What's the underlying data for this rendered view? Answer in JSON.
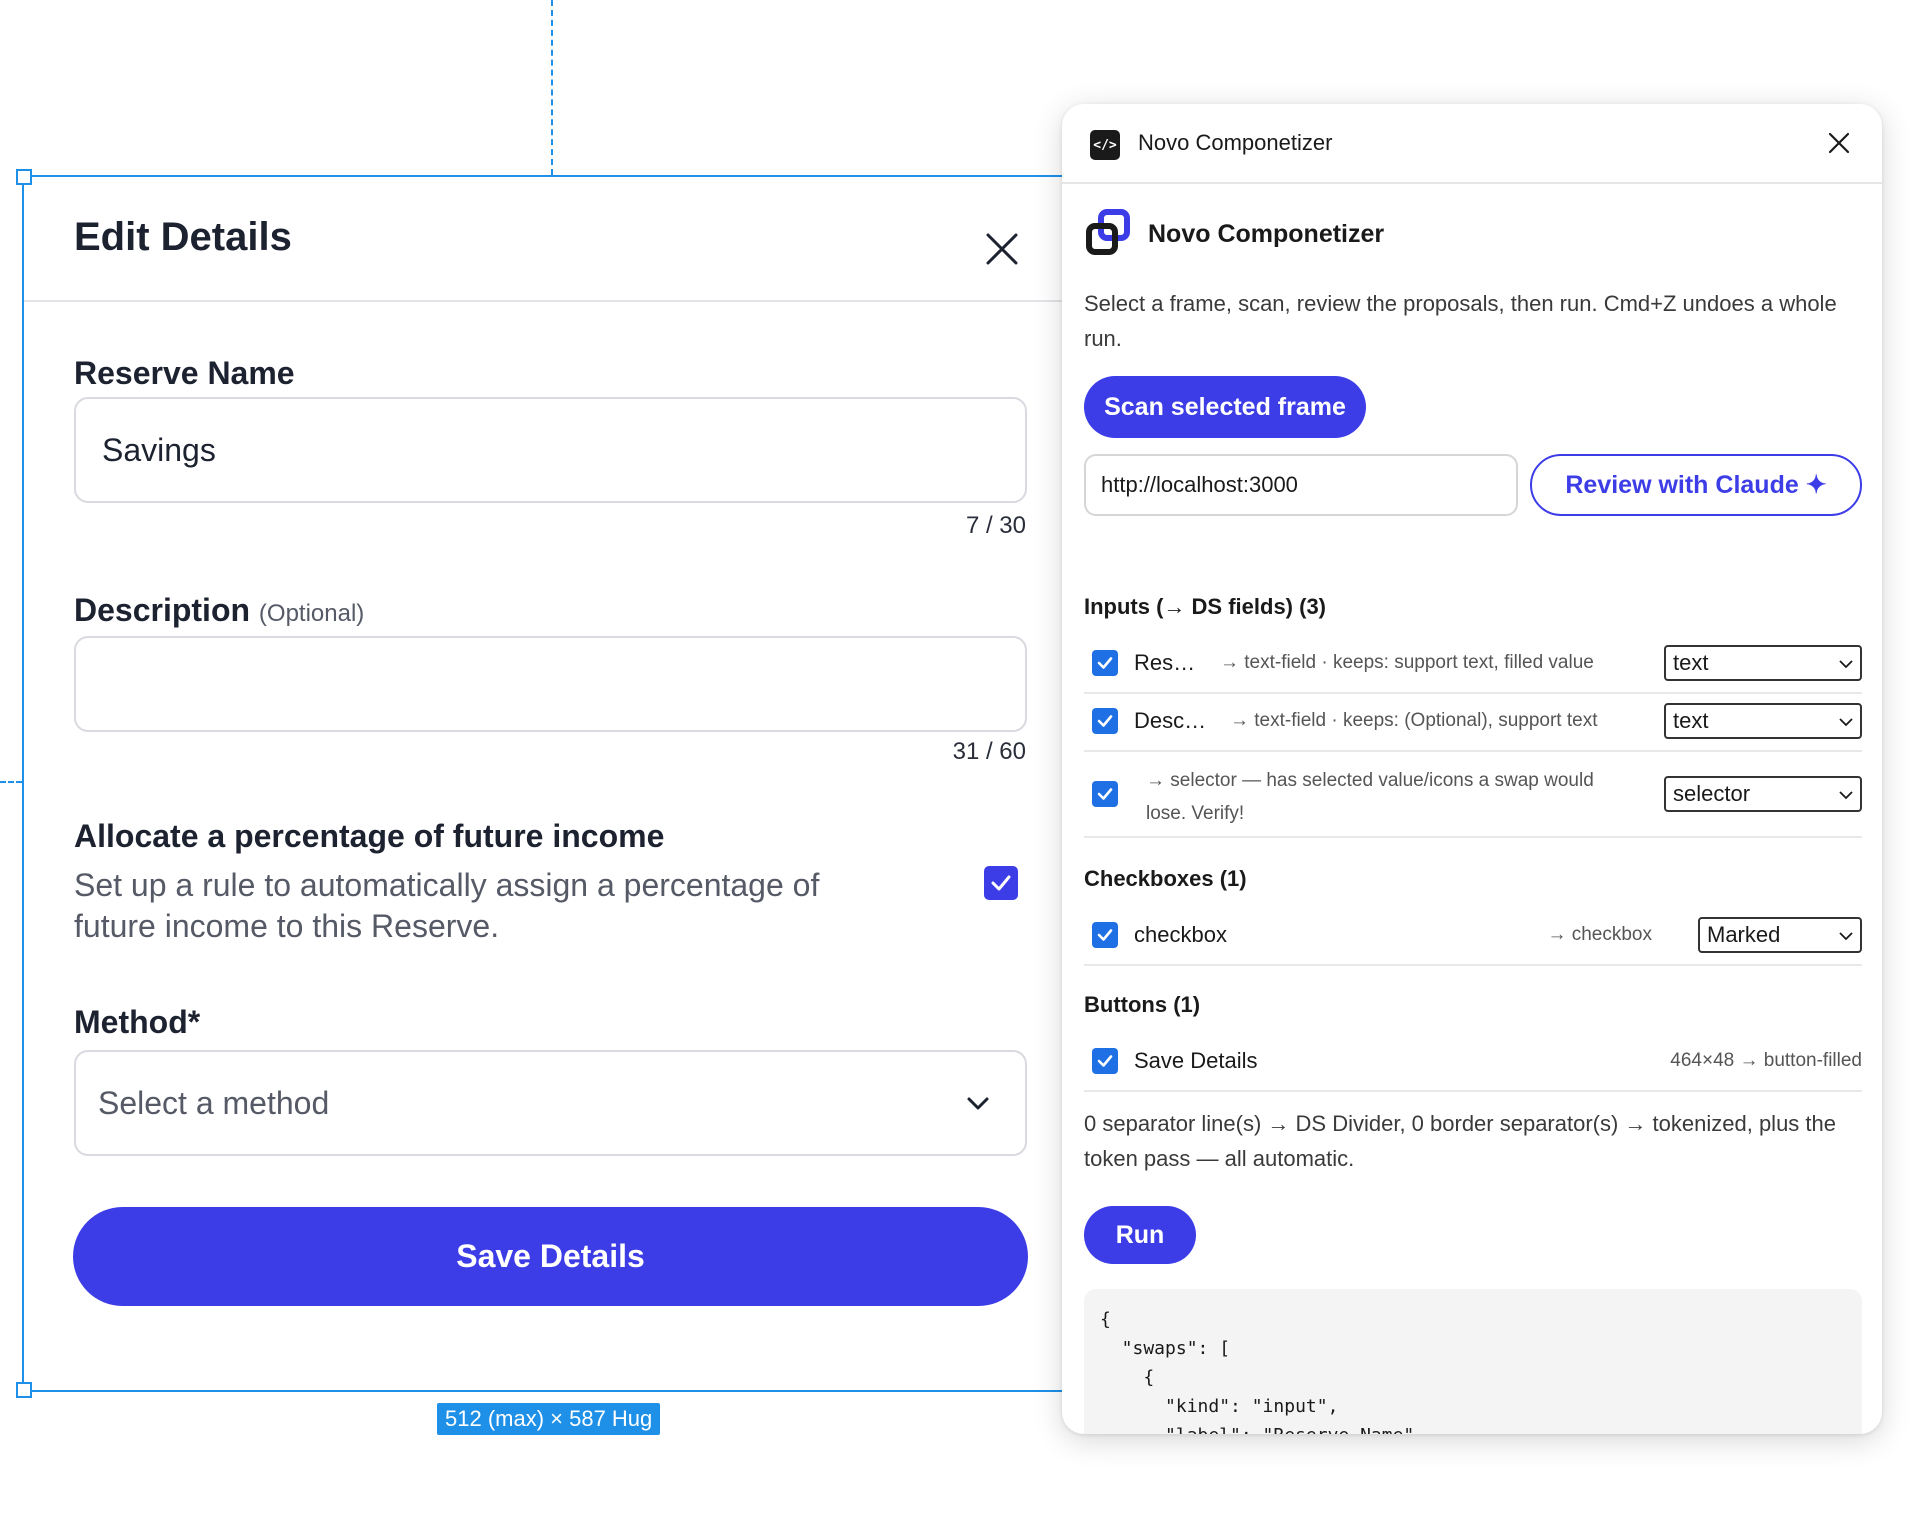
{
  "canvas": {
    "dimension_badge": "512 (max) × 587 Hug"
  },
  "form": {
    "title": "Edit Details",
    "reserve_name": {
      "label": "Reserve Name",
      "value": "Savings",
      "counter": "7 / 30"
    },
    "description": {
      "label": "Description",
      "optional": "(Optional)",
      "value": "",
      "counter": "31 / 60"
    },
    "allocate": {
      "title": "Allocate a percentage of future income",
      "description": "Set up a rule to automatically assign a percentage of future income to this Reserve.",
      "checked": true
    },
    "method": {
      "label": "Method*",
      "placeholder": "Select a method"
    },
    "save_label": "Save Details",
    "accent_color": "#3d3de8"
  },
  "panel": {
    "header_title": "Novo Componetizer",
    "app_icon_glyph": "</>",
    "brand_title": "Novo Componetizer",
    "intro": "Select a frame, scan, review the proposals, then run. Cmd+Z undoes a whole run.",
    "scan_label": "Scan selected frame",
    "url_value": "http://localhost:3000",
    "review_label": "Review with Claude ✦",
    "inputs_section": "Inputs (→ DS fields) (3)",
    "inputs": [
      {
        "name": "Res…",
        "desc": "→ text-field · keeps: support text, filled value",
        "select": "text",
        "checked": true
      },
      {
        "name": "Desc…",
        "desc": "→ text-field · keeps: (Optional), support text",
        "select": "text",
        "checked": true
      },
      {
        "name": "",
        "desc": "→ selector — has selected value/icons a swap would lose. Verify!",
        "select": "selector",
        "checked": true
      }
    ],
    "checkboxes_section": "Checkboxes (1)",
    "checkboxes": [
      {
        "name": "checkbox",
        "desc": "→ checkbox",
        "select": "Marked",
        "checked": true
      }
    ],
    "buttons_section": "Buttons (1)",
    "buttons": [
      {
        "name": "Save Details",
        "desc": "464×48 → button-filled",
        "checked": true
      }
    ],
    "footer_note": "0 separator line(s) → DS Divider, 0 border separator(s) → tokenized, plus the token pass — all automatic.",
    "run_label": "Run",
    "code_preview": "{\n  \"swaps\": [\n    {\n      \"kind\": \"input\",\n      \"label\": \"Reserve Name\","
  }
}
